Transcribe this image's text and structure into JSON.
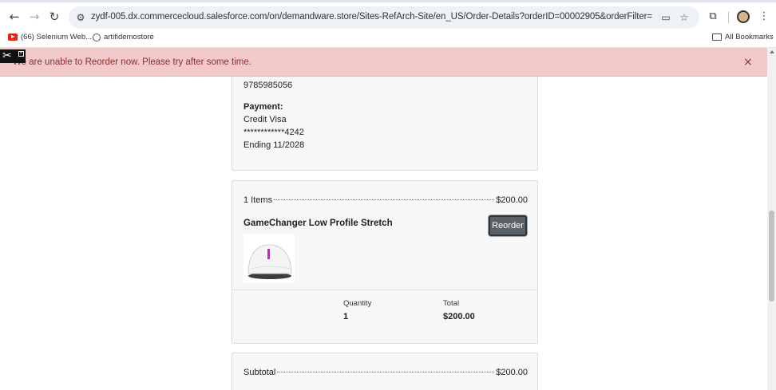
{
  "browser": {
    "url": "zydf-005.dx.commercecloud.salesforce.com/on/demandware.store/Sites-RefArch-Site/en_US/Order-Details?orderID=00002905&orderFilter=",
    "bookmarks": [
      "(66) Selenium Web...",
      "artifidemostore"
    ],
    "all_bookmarks_label": "All Bookmarks"
  },
  "alert": {
    "message": "We are unable to Reorder now. Please try after some time.",
    "close_symbol": "×"
  },
  "order": {
    "phone": "9785985056",
    "payment": {
      "heading": "Payment:",
      "method": "Credit Visa",
      "card_number": "************4242",
      "expiry": "Ending 11/2028"
    },
    "items_summary": {
      "label": "1 Items",
      "amount": "$200.00"
    },
    "product": {
      "name": "GameChanger Low Profile Stretch",
      "reorder_label": "Reorder",
      "quantity_label": "Quantity",
      "quantity": "1",
      "total_label": "Total",
      "total": "$200.00"
    },
    "subtotal": {
      "label": "Subtotal",
      "amount": "$200.00"
    }
  },
  "colors": {
    "alert_bg": "#f2c9c9",
    "alert_text": "#8a2f2f",
    "card_bg": "#f7f7f7",
    "button_bg": "#5a6268"
  }
}
